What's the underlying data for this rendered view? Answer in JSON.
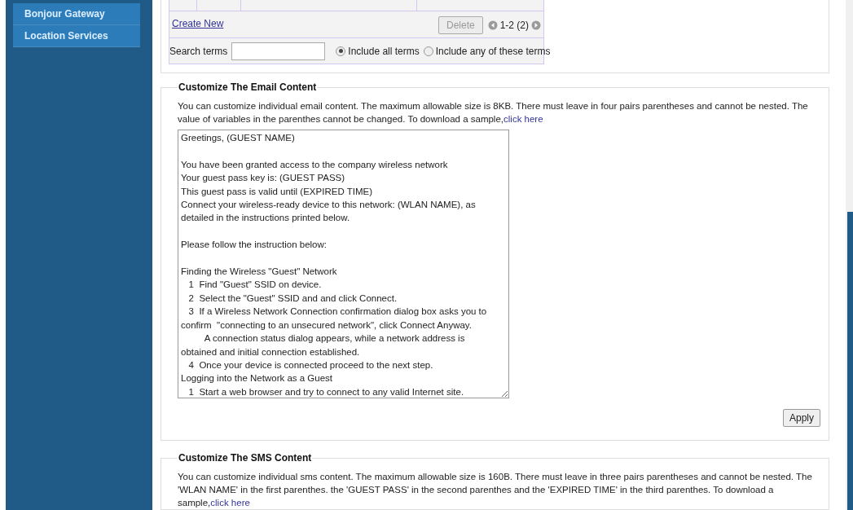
{
  "sidebar": {
    "items": [
      {
        "label": "Bonjour Gateway",
        "selected": false
      },
      {
        "label": "Location Services",
        "selected": false
      }
    ]
  },
  "templates": {
    "create_new": "Create New",
    "delete_button": {
      "label": "Delete",
      "disabled": true
    },
    "pagination": "1-2 (2)",
    "search": {
      "label": "Search terms"
    },
    "match_options": [
      {
        "label": "Include all terms",
        "selected": true
      },
      {
        "label": "Include any of these terms",
        "selected": false
      }
    ]
  },
  "email_section": {
    "title": "Customize The Email Content",
    "description": "You can customize individual email content. The maximum allowable size is 8KB. There must leave in four pairs parentheses and cannot be nested. The value of variables in the parenthes cannot be changed. To download a sample,",
    "link": "click here",
    "content": "Greetings, (GUEST NAME)\n\nYou have been granted access to the company wireless network\nYour guest pass key is: (GUEST PASS)\nThis guest pass is valid until (EXPIRED TIME)\nConnect your wireless-ready device to this network: (WLAN NAME), as detailed in the instructions printed below.\n\nPlease follow the instruction below:\n\nFinding the Wireless \"Guest\" Network\n   1  Find \"Guest\" SSID on device.\n   2  Select the \"Guest\" SSID and and click Connect.\n   3  If a Wireless Network Connection confirmation dialog box asks you to confirm  \"connecting to an unsecured network\", click Connect Anyway.\n         A connection status dialog appears, while a network address is obtained and initial connection established.\n   4  Once your device is connected proceed to the next step.\nLogging into the Network as a Guest\n   1  Start a web browser and try to connect to any valid Internet site.",
    "apply_button": "Apply"
  },
  "sms_section": {
    "title": "Customize The SMS Content",
    "description": "You can customize individual sms content. The maximum allowable size is 160B. There must leave in three pairs parentheses and cannot be nested. The 'WLAN NAME' in the first parenthes. the 'GUEST PASS' in the second parenthes and the 'EXPIRED TIME' in the third parenthes. To download a sample,",
    "link": "click here"
  }
}
